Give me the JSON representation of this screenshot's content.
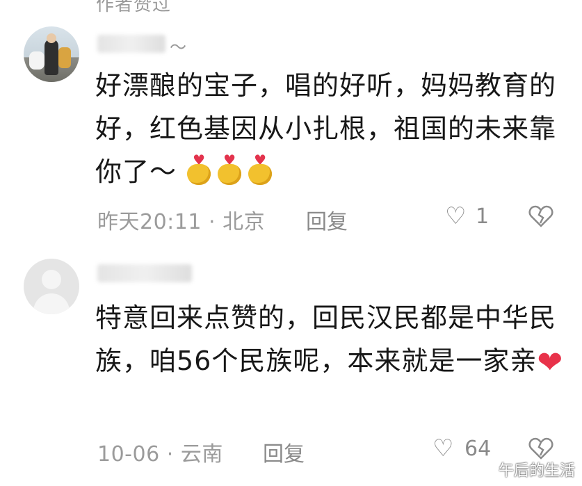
{
  "top_label": "作者赞过",
  "comments": [
    {
      "username": "～",
      "text_main": "好漂酿的宝子，唱的好听，妈妈教育的好，红色基因从小扎根，祖国的未来靠你了～",
      "emoji_1": "heart-hands-emoji",
      "emoji_2": "heart-hands-emoji",
      "emoji_3": "heart-hands-emoji",
      "time": "昨天20:11",
      "location": "北京",
      "separator": "·",
      "reply": "回复",
      "likes": "1"
    },
    {
      "username": "",
      "text_main": "特意回来点赞的，回民汉民都是中华民族，咱56个民族呢，本来就是一家亲",
      "emoji": "red-heart-emoji",
      "time": "10-06",
      "location": "云南",
      "separator": "·",
      "reply": "回复",
      "likes": "64"
    }
  ],
  "icons": {
    "like": "heart-outline-icon",
    "dislike": "broken-heart-icon"
  },
  "watermark": "午后的生活",
  "colors": {
    "text": "#171717",
    "meta": "#9b9b9b",
    "emoji_heart": "#e8324a",
    "emoji_hand": "#f2c12e"
  }
}
